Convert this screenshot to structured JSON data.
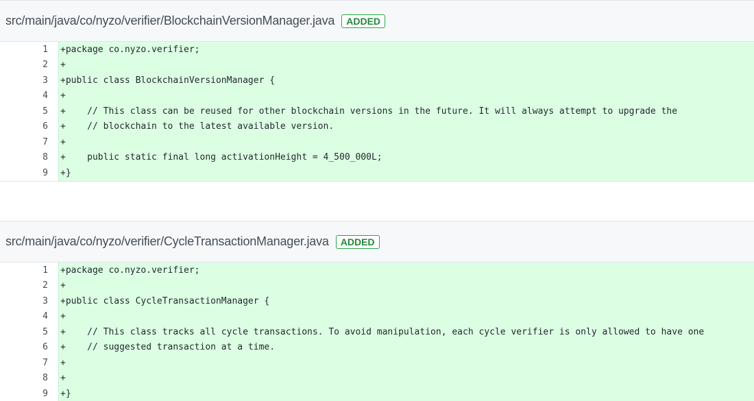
{
  "files": [
    {
      "path": "src/main/java/co/nyzo/verifier/BlockchainVersionManager.java",
      "status": "ADDED",
      "lines": [
        {
          "num": "1",
          "text": "+package co.nyzo.verifier;"
        },
        {
          "num": "2",
          "text": "+"
        },
        {
          "num": "3",
          "text": "+public class BlockchainVersionManager {"
        },
        {
          "num": "4",
          "text": "+"
        },
        {
          "num": "5",
          "text": "+    // This class can be reused for other blockchain versions in the future. It will always attempt to upgrade the"
        },
        {
          "num": "6",
          "text": "+    // blockchain to the latest available version."
        },
        {
          "num": "7",
          "text": "+"
        },
        {
          "num": "8",
          "text": "+    public static final long activationHeight = 4_500_000L;"
        },
        {
          "num": "9",
          "text": "+}"
        }
      ]
    },
    {
      "path": "src/main/java/co/nyzo/verifier/CycleTransactionManager.java",
      "status": "ADDED",
      "lines": [
        {
          "num": "1",
          "text": "+package co.nyzo.verifier;"
        },
        {
          "num": "2",
          "text": "+"
        },
        {
          "num": "3",
          "text": "+public class CycleTransactionManager {"
        },
        {
          "num": "4",
          "text": "+"
        },
        {
          "num": "5",
          "text": "+    // This class tracks all cycle transactions. To avoid manipulation, each cycle verifier is only allowed to have one"
        },
        {
          "num": "6",
          "text": "+    // suggested transaction at a time."
        },
        {
          "num": "7",
          "text": "+"
        },
        {
          "num": "8",
          "text": "+"
        },
        {
          "num": "9",
          "text": "+}"
        }
      ]
    }
  ]
}
